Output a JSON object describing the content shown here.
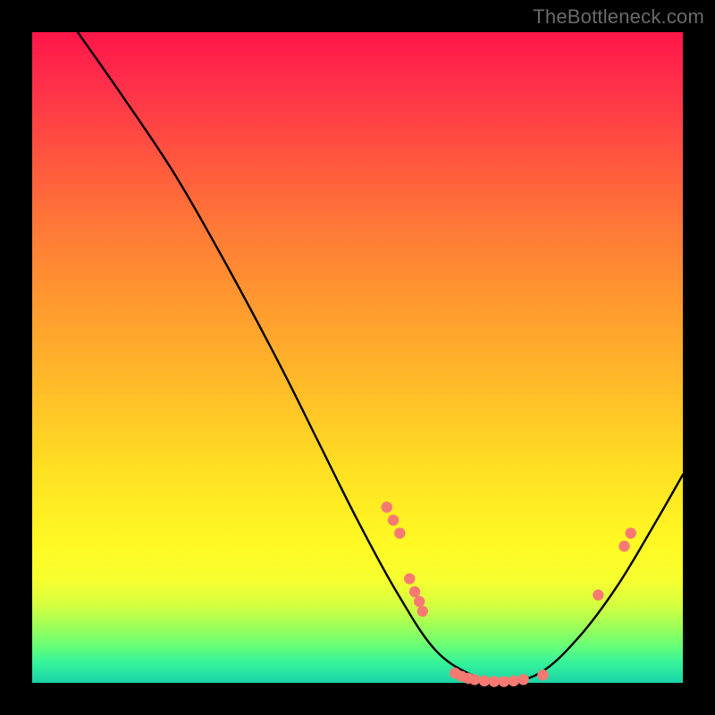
{
  "watermark": "TheBottleneck.com",
  "colors": {
    "curve": "#000000",
    "dot_fill": "#f77a72",
    "dot_stroke": "#d9584f"
  },
  "chart_data": {
    "type": "line",
    "title": "",
    "xlabel": "",
    "ylabel": "",
    "xlim": [
      0,
      100
    ],
    "ylim": [
      0,
      100
    ],
    "note": "Axes are unlabeled; values are estimated percentages of plot width/height. Curve is a bottleneck V-shape: steep left descent, trough near x≈72, right rise.",
    "curve_points": [
      {
        "x": 7.0,
        "y": 100.0
      },
      {
        "x": 14.0,
        "y": 90.0
      },
      {
        "x": 22.0,
        "y": 78.0
      },
      {
        "x": 30.0,
        "y": 64.0
      },
      {
        "x": 38.0,
        "y": 49.0
      },
      {
        "x": 44.0,
        "y": 37.0
      },
      {
        "x": 50.0,
        "y": 25.0
      },
      {
        "x": 56.0,
        "y": 14.0
      },
      {
        "x": 62.0,
        "y": 5.0
      },
      {
        "x": 68.0,
        "y": 1.0
      },
      {
        "x": 72.0,
        "y": 0.0
      },
      {
        "x": 78.0,
        "y": 1.5
      },
      {
        "x": 84.0,
        "y": 7.0
      },
      {
        "x": 90.0,
        "y": 15.0
      },
      {
        "x": 96.0,
        "y": 25.0
      },
      {
        "x": 100.0,
        "y": 32.0
      }
    ],
    "dots": [
      {
        "x": 54.5,
        "y": 27.0
      },
      {
        "x": 55.5,
        "y": 25.0
      },
      {
        "x": 56.5,
        "y": 23.0
      },
      {
        "x": 58.0,
        "y": 16.0
      },
      {
        "x": 58.8,
        "y": 14.0
      },
      {
        "x": 59.5,
        "y": 12.5
      },
      {
        "x": 60.0,
        "y": 11.0
      },
      {
        "x": 65.0,
        "y": 1.5
      },
      {
        "x": 66.0,
        "y": 1.0
      },
      {
        "x": 67.0,
        "y": 0.7
      },
      {
        "x": 68.0,
        "y": 0.5
      },
      {
        "x": 69.5,
        "y": 0.3
      },
      {
        "x": 71.0,
        "y": 0.2
      },
      {
        "x": 72.5,
        "y": 0.2
      },
      {
        "x": 74.0,
        "y": 0.3
      },
      {
        "x": 75.5,
        "y": 0.5
      },
      {
        "x": 78.5,
        "y": 1.2
      },
      {
        "x": 87.0,
        "y": 13.5
      },
      {
        "x": 91.0,
        "y": 21.0
      },
      {
        "x": 92.0,
        "y": 23.0
      }
    ]
  }
}
